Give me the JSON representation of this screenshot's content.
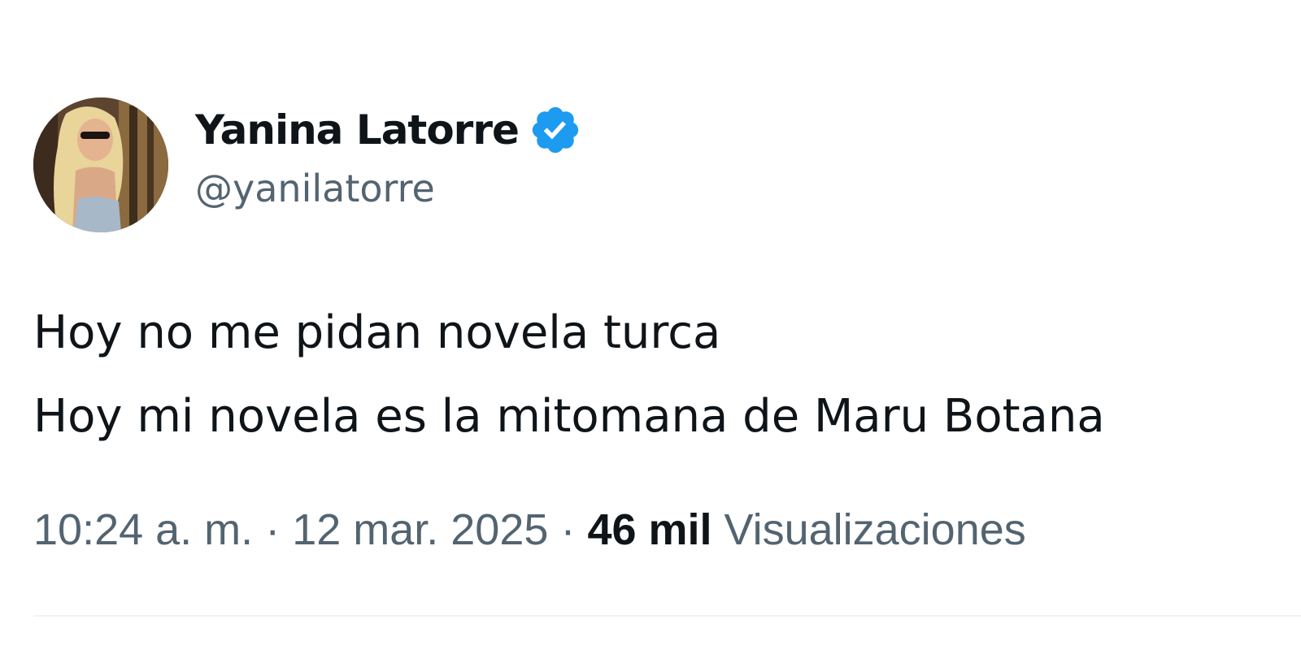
{
  "author": {
    "display_name": "Yanina Latorre",
    "handle": "@yanilatorre",
    "verified": true,
    "verified_color": "#1d9bf0",
    "avatar_icon": "profile-photo"
  },
  "tweet": {
    "lines": [
      "Hoy no me pidan novela turca",
      "Hoy mi novela es la mitomana de Maru Botana"
    ]
  },
  "meta": {
    "time": "10:24 a. m.",
    "separator": "·",
    "date": "12 mar. 2025",
    "views_count": "46 mil",
    "views_label": "Visualizaciones"
  },
  "colors": {
    "text_primary": "#0f1419",
    "text_secondary": "#536471",
    "divider": "#eff3f4",
    "background": "#ffffff"
  }
}
